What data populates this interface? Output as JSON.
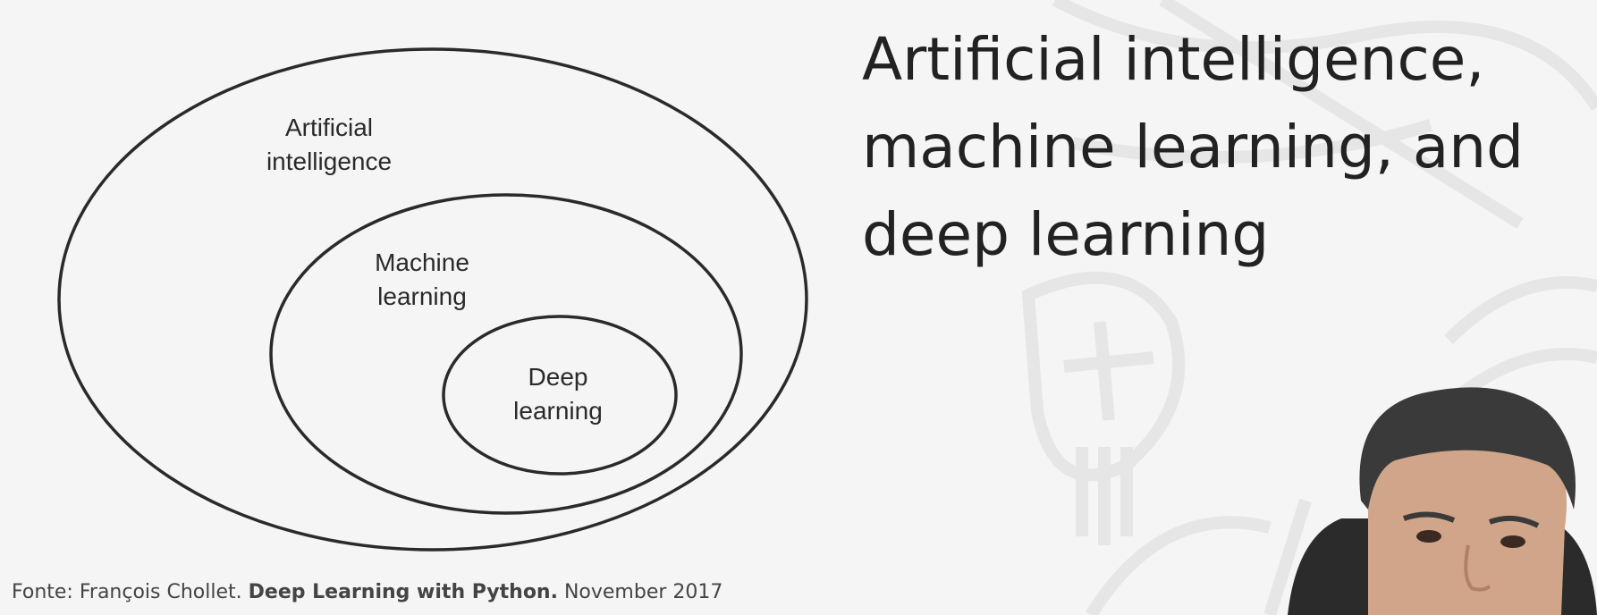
{
  "diagram": {
    "outer_label": [
      "Artificial",
      "intelligence"
    ],
    "middle_label": [
      "Machine",
      "learning"
    ],
    "inner_label": [
      "Deep",
      "learning"
    ]
  },
  "slide_title": [
    "Artificial intelligence,",
    "machine learning, and",
    "deep learning"
  ],
  "source": {
    "prefix": "Fonte: François Chollet.",
    "book": "Deep Learning with Python.",
    "date": "November 2017"
  },
  "colors": {
    "background": "#f5f5f5",
    "ink": "#2a2a2a"
  },
  "icons": [
    "university-seal-watermark-icon",
    "presenter-webcam-video"
  ]
}
